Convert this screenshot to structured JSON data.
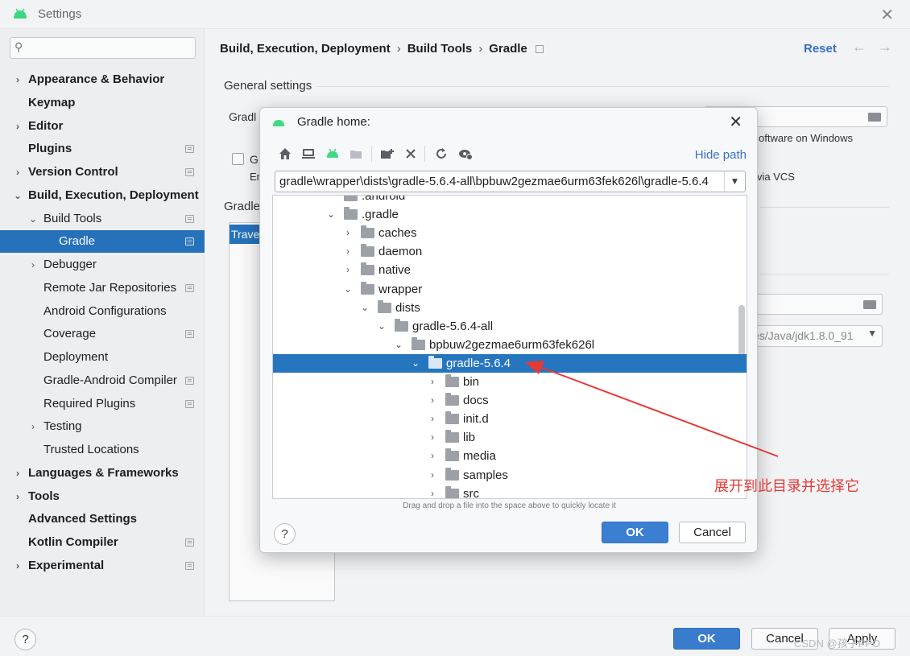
{
  "window": {
    "title": "Settings",
    "close_glyph": "✕"
  },
  "sidebar": {
    "search_placeholder": "",
    "items": [
      {
        "label": "Appearance & Behavior"
      },
      {
        "label": "Keymap"
      },
      {
        "label": "Editor"
      },
      {
        "label": "Plugins"
      },
      {
        "label": "Version Control"
      },
      {
        "label": "Build, Execution, Deployment"
      },
      {
        "label": "Build Tools"
      },
      {
        "label": "Gradle"
      },
      {
        "label": "Debugger"
      },
      {
        "label": "Remote Jar Repositories"
      },
      {
        "label": "Android Configurations"
      },
      {
        "label": "Coverage"
      },
      {
        "label": "Deployment"
      },
      {
        "label": "Gradle-Android Compiler"
      },
      {
        "label": "Required Plugins"
      },
      {
        "label": "Testing"
      },
      {
        "label": "Trusted Locations"
      },
      {
        "label": "Languages & Frameworks"
      },
      {
        "label": "Tools"
      },
      {
        "label": "Advanced Settings"
      },
      {
        "label": "Kotlin Compiler"
      },
      {
        "label": "Experimental"
      }
    ]
  },
  "main": {
    "breadcrumb": [
      "Build, Execution, Deployment",
      "Build Tools",
      "Gradle"
    ],
    "breadcrumb_sep": "›",
    "reset": "Reset",
    "back_glyph": "←",
    "forward_glyph": "→",
    "section_title": "General settings",
    "gradle_label_partial": "Gradl",
    "checkbox_label_partial": "G",
    "checkbox_sub_partial": "En",
    "gradle_list_label_partial": "Gradle",
    "list_row_partial": "Trave",
    "right_text_1": "oftware on Windows",
    "right_text_2": "via VCS",
    "jdk_field_partial": "es/Java/jdk1.8.0_91"
  },
  "footer": {
    "help": "?",
    "ok": "OK",
    "cancel": "Cancel",
    "apply": "Apply"
  },
  "watermark": "CSDN @孩子PPO",
  "dialog": {
    "title": "Gradle home:",
    "close_glyph": "✕",
    "hide_path": "Hide path",
    "path_value": "gradle\\wrapper\\dists\\gradle-5.6.4-all\\bpbuw2gezmae6urm63fek626l\\gradle-5.6.4",
    "dropdown_glyph": "▼",
    "toolbar_icons": [
      "home-icon",
      "desktop-icon",
      "android-icon",
      "project-folder-icon",
      "new-folder-icon",
      "delete-icon",
      "refresh-icon",
      "show-hidden-icon"
    ],
    "tree": [
      {
        "label": ".android",
        "chev": "",
        "state": "partial"
      },
      {
        "label": ".gradle",
        "chev": "⌄"
      },
      {
        "label": "caches",
        "chev": "›"
      },
      {
        "label": "daemon",
        "chev": "›"
      },
      {
        "label": "native",
        "chev": "›"
      },
      {
        "label": "wrapper",
        "chev": "⌄"
      },
      {
        "label": "dists",
        "chev": "⌄"
      },
      {
        "label": "gradle-5.6.4-all",
        "chev": "⌄"
      },
      {
        "label": "bpbuw2gezmae6urm63fek626l",
        "chev": "⌄"
      },
      {
        "label": "gradle-5.6.4",
        "chev": "⌄",
        "selected": true
      },
      {
        "label": "bin",
        "chev": "›"
      },
      {
        "label": "docs",
        "chev": "›"
      },
      {
        "label": "init.d",
        "chev": "›"
      },
      {
        "label": "lib",
        "chev": "›"
      },
      {
        "label": "media",
        "chev": "›"
      },
      {
        "label": "samples",
        "chev": "›"
      },
      {
        "label": "src",
        "chev": "›"
      }
    ],
    "hint": "Drag and drop a file into the space above to quickly locate it",
    "help": "?",
    "ok": "OK",
    "cancel": "Cancel"
  },
  "annotation": {
    "text": "展开到此目录并选择它",
    "color": "#e53935"
  },
  "colors": {
    "selection": "#2675bf",
    "link": "#3a72c4",
    "primary_button": "#3b7fd3",
    "android_green": "#3ddc84"
  }
}
